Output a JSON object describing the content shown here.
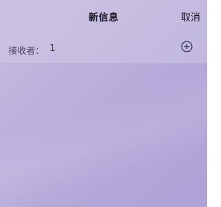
{
  "header": {
    "title": "新信息",
    "cancel_label": "取消"
  },
  "recipient": {
    "label": "接收者：",
    "value": "1",
    "add_icon": "plus-circle-icon"
  },
  "colors": {
    "background": "#b8acda",
    "text": "#1c1a26",
    "icon": "#3a3458"
  }
}
